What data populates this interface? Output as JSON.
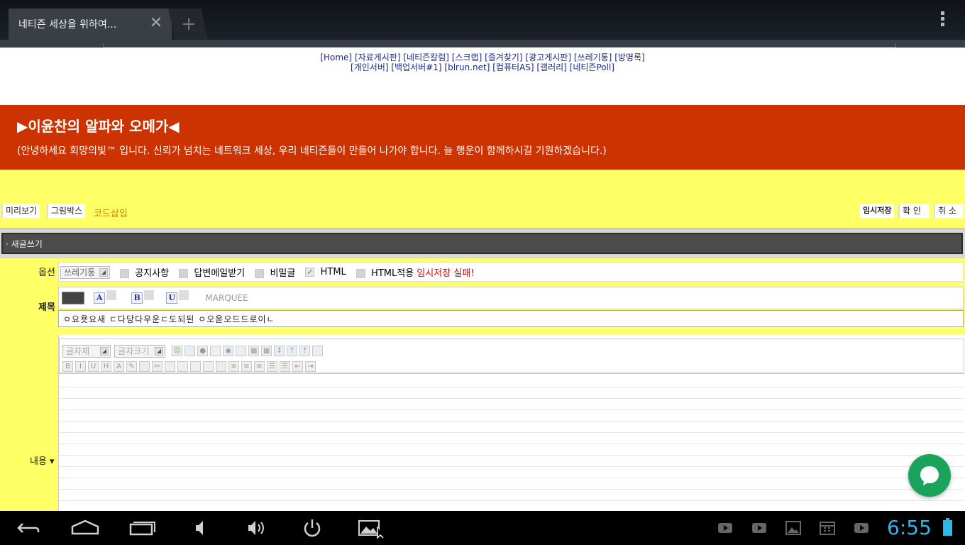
{
  "browser": {
    "tab_title": "네티즌 세상을 위하여...",
    "tab_close_glyph": "✕",
    "new_tab_glyph": "+",
    "icons": [
      "close-icon",
      "plus-icon",
      "overflow-menu-icon"
    ]
  },
  "nav": {
    "row1": [
      "[Home]",
      "[자료게시판]",
      "[네티즌칼럼]",
      "[스크랩]",
      "[즐겨찾기]",
      "[광고게시판]",
      "[쓰레기통]",
      "[방명록]"
    ],
    "row2": [
      "[개인서버]",
      "[백업서버#1]",
      "[blrun.net]",
      "[컴퓨터AS]",
      "[갤러리]",
      "[네티즌Poll]"
    ]
  },
  "banner": {
    "title": "▶이윤찬의 알파와 오메가◀",
    "subtitle": "(안녕하세요 회망의빛™ 입니다. 신뢰가 넘치는 네트워크 세상, 우리 네티즌들이 만들어 나가야 합니다. 늘 행운이 함께하시길 기원하겠습니다.)",
    "bg_color": "#cc3300"
  },
  "actions": {
    "preview": "미리보기",
    "picture_box": "그림박스",
    "code_insert": "코드삽입",
    "temp_save": "임시저장",
    "confirm": "확 인",
    "cancel": "취 소"
  },
  "form": {
    "header": "· 새글쓰기",
    "options_label": "옵션",
    "category_value": "쓰레기통",
    "notice": "공지사항",
    "reply_mail": "답변메일받기",
    "secret": "비밀글",
    "html": "HTML",
    "html_apply": "HTML적용",
    "html_checked": true,
    "temp_save_status": "임시저장 실패!",
    "title_label": "제목",
    "marquee": "MARQUEE",
    "title_value": "ㅇ요욧요새 ㄷ다당다우운ㄷ도되된 ㅇ오옫오드드로이ㄴ",
    "content_label": "내용 ▾",
    "font_placeholder": "글자체",
    "size_placeholder": "글자크기"
  },
  "system": {
    "clock": "6:55",
    "accent_color": "#33b5e5",
    "nav_icons": [
      "back-icon",
      "home-icon",
      "recent-apps-icon",
      "volume-down-icon",
      "volume-up-icon",
      "power-icon",
      "screenshot-icon"
    ],
    "tray_icons": [
      "youtube-icon",
      "youtube-icon",
      "gallery-icon",
      "calendar-icon",
      "youtube-icon",
      "battery-icon"
    ]
  }
}
